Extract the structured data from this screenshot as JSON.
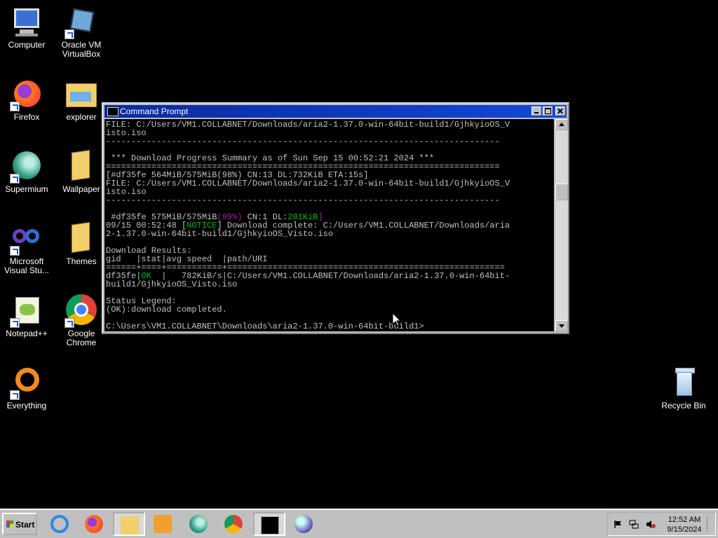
{
  "desktop_icons": [
    {
      "label": "Computer",
      "icon": "computer-icon"
    },
    {
      "label": "Oracle VM VirtualBox",
      "icon": "virtualbox-icon"
    },
    {
      "label": "Firefox",
      "icon": "firefox-icon"
    },
    {
      "label": "explorer",
      "icon": "folder-icon"
    },
    {
      "label": "Supermium",
      "icon": "supermium-icon"
    },
    {
      "label": "Wallpaper",
      "icon": "folder-icon"
    },
    {
      "label": "Microsoft Visual Stu...",
      "icon": "visual-studio-icon"
    },
    {
      "label": "Themes",
      "icon": "folder-icon"
    },
    {
      "label": "Notepad++",
      "icon": "notepadpp-icon"
    },
    {
      "label": "Google Chrome",
      "icon": "chrome-icon"
    },
    {
      "label": "Everything",
      "icon": "everything-icon"
    },
    {
      "label": "Recycle Bin",
      "icon": "recycle-bin-icon"
    }
  ],
  "window": {
    "title": "Command Prompt",
    "console_lines": [
      "FILE: C:/Users/VM1.COLLABNET/Downloads/aria2-1.37.0-win-64bit-build1/GjhkyioOS_V",
      "isto.iso",
      "------------------------------------------------------------------------------",
      "",
      " *** Download Progress Summary as of Sun Sep 15 00:52:21 2024 ***",
      "==============================================================================",
      "[#df35fe 564MiB/575MiB(98%) CN:13 DL:732KiB ETA:15s]",
      "FILE: C:/Users/VM1.COLLABNET/Downloads/aria2-1.37.0-win-64bit-build1/GjhkyioOS_V",
      "isto.iso",
      "------------------------------------------------------------------------------",
      "",
      " #df35fe 575MiB/575MiB",
      "09/15 00:52:48 [",
      "2-1.37.0-win-64bit-build1/GjhkyioOS_Visto.iso",
      "",
      "Download Results:",
      "gid   |stat|avg speed  |path/URI",
      "======+====+===========+=======================================================",
      "df35fe|",
      "build1/GjhkyioOS_Visto.iso",
      "",
      "Status Legend:",
      "(OK):download completed.",
      "",
      "C:\\Users\\VM1.COLLABNET\\Downloads\\aria2-1.37.0-win-64bit-build1>"
    ],
    "progress_line": {
      "pct": "(99%)",
      "rest": " CN:1 DL:",
      "dl": "201KiB",
      "end": "]"
    },
    "notice_line": {
      "tag": "NOTICE",
      "rest": "] Download complete: C:/Users/VM1.COLLABNET/Downloads/aria"
    },
    "result_line": {
      "ok": "OK",
      "rest": "  |   782KiB/s|C:/Users/VM1.COLLABNET/Downloads/aria2-1.37.0-win-64bit-"
    }
  },
  "taskbar": {
    "start_label": "Start",
    "apps": [
      "internet-explorer-icon",
      "firefox-icon",
      "file-explorer-icon",
      "media-player-icon",
      "supermium-icon",
      "chrome-icon",
      "command-prompt-icon",
      "virtualbox-icon"
    ],
    "clock_time": "12:52 AM",
    "clock_date": "9/15/2024"
  }
}
